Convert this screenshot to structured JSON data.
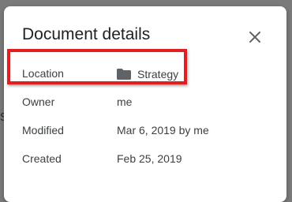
{
  "background": {
    "partial_glyph": "s"
  },
  "dialog": {
    "title": "Document details",
    "close_icon": "close-icon",
    "details": [
      {
        "label": "Location",
        "value": "Strategy",
        "icon": "folder-icon"
      },
      {
        "label": "Owner",
        "value": "me"
      },
      {
        "label": "Modified",
        "value": "Mar 6, 2019 by me"
      },
      {
        "label": "Created",
        "value": "Feb 25, 2019"
      }
    ]
  },
  "annotation": {
    "highlight_color": "#e02020"
  }
}
